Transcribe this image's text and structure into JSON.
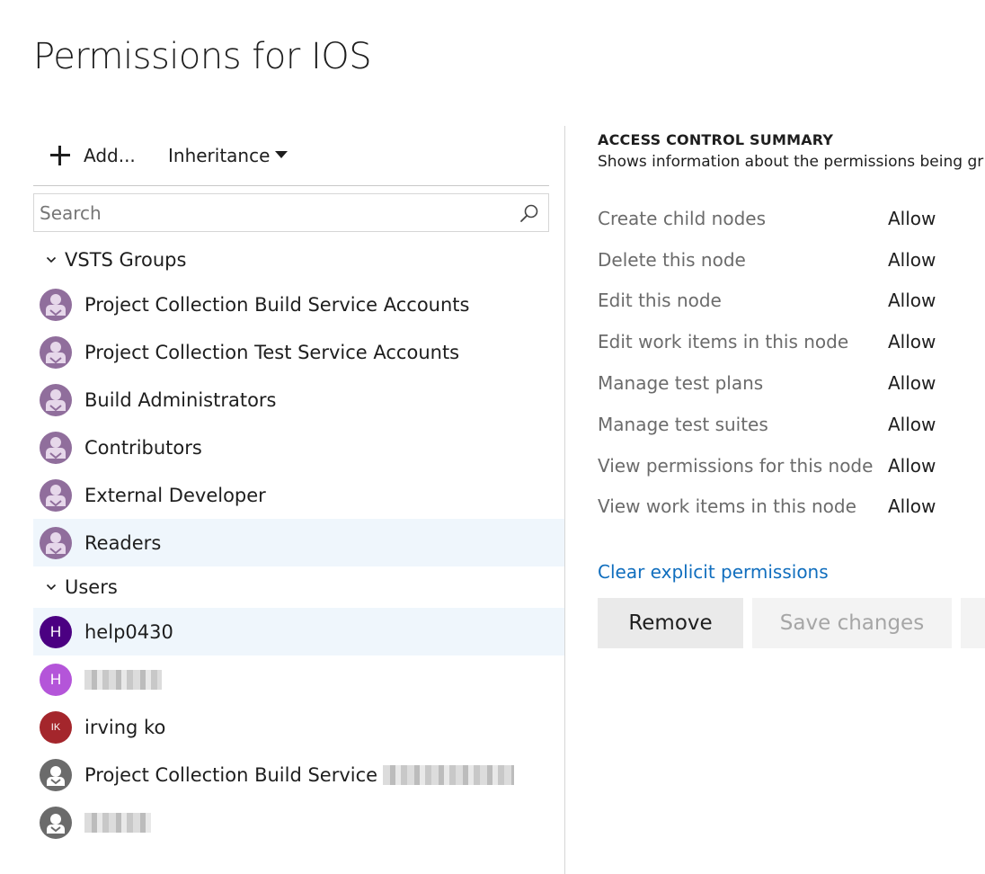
{
  "page": {
    "title": "Permissions for IOS"
  },
  "toolbar": {
    "add_label": "Add...",
    "inheritance_label": "Inheritance"
  },
  "search": {
    "placeholder": "Search"
  },
  "groups_section": {
    "label": "VSTS Groups",
    "items": [
      {
        "label": "Project Collection Build Service Accounts"
      },
      {
        "label": "Project Collection Test Service Accounts"
      },
      {
        "label": "Build Administrators"
      },
      {
        "label": "Contributors"
      },
      {
        "label": "External Developer"
      },
      {
        "label": "Readers",
        "selected": true
      }
    ]
  },
  "users_section": {
    "label": "Users",
    "items": [
      {
        "label": "help0430",
        "initial": "H",
        "color": "#4b0082",
        "selected": true
      },
      {
        "initial": "H",
        "color": "#b455d9"
      },
      {
        "label": "irving ko",
        "initial": "IK",
        "color": "#a4262c"
      },
      {
        "label": "Project Collection Build Service"
      },
      {
        "label": ""
      }
    ]
  },
  "summary": {
    "title": "ACCESS CONTROL SUMMARY",
    "description": "Shows information about the permissions being gr",
    "permissions": [
      {
        "name": "Create child nodes",
        "value": "Allow"
      },
      {
        "name": "Delete this node",
        "value": "Allow"
      },
      {
        "name": "Edit this node",
        "value": "Allow"
      },
      {
        "name": "Edit work items in this node",
        "value": "Allow"
      },
      {
        "name": "Manage test plans",
        "value": "Allow"
      },
      {
        "name": "Manage test suites",
        "value": "Allow"
      },
      {
        "name": "View permissions for this node",
        "value": "Allow"
      },
      {
        "name": "View work items in this node",
        "value": "Allow"
      }
    ],
    "clear_link": "Clear explicit permissions"
  },
  "actions": {
    "remove_label": "Remove",
    "save_label": "Save changes"
  },
  "colors": {
    "accent_link": "#106ebe",
    "selection": "#eff6fc",
    "group_avatar": "#906e9c"
  },
  "icons": {
    "add": "plus-icon",
    "dropdown": "caret-down-icon",
    "search": "search-icon",
    "expand": "chevron-down-icon",
    "group": "group-avatar-icon",
    "user": "user-avatar-icon"
  }
}
